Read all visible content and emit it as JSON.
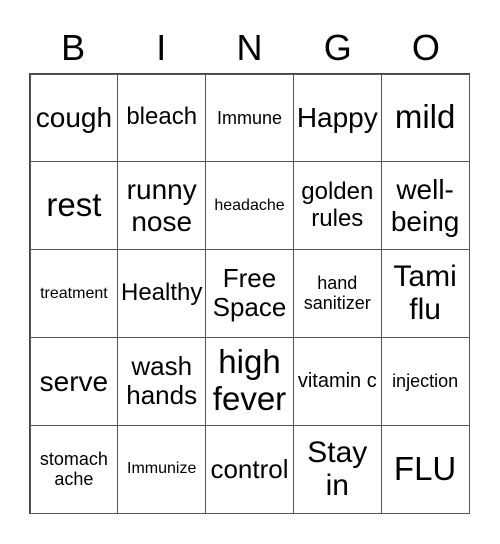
{
  "header": [
    "B",
    "I",
    "N",
    "G",
    "O"
  ],
  "cells": [
    [
      "cough",
      "bleach",
      "Immune",
      "Happy",
      "mild"
    ],
    [
      "rest",
      "runny nose",
      "headache",
      "golden rules",
      "well-being"
    ],
    [
      "treatment",
      "Healthy",
      "Free Space",
      "hand sanitizer",
      "Tami flu"
    ],
    [
      "serve",
      "wash hands",
      "high fever",
      "vitamin c",
      "injection"
    ],
    [
      "stomach ache",
      "Immunize",
      "control",
      "Stay in",
      "FLU"
    ]
  ]
}
